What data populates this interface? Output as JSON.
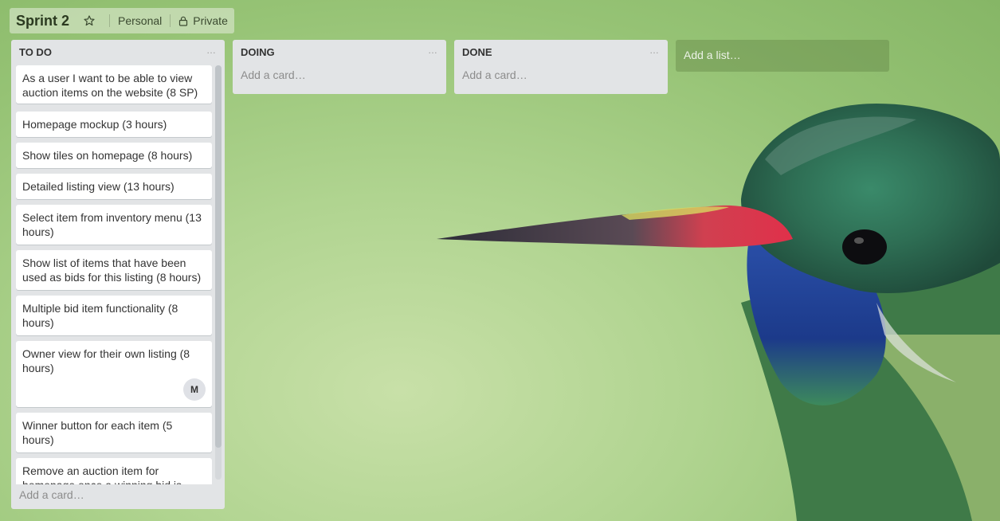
{
  "header": {
    "title": "Sprint 2",
    "star_icon": "star-outline-icon",
    "team": "Personal",
    "visibility_icon": "lock-icon",
    "visibility": "Private"
  },
  "lists": [
    {
      "title": "TO DO",
      "menu": "…",
      "add_card": "Add a card…",
      "cards": [
        {
          "text": "As a user I want to be able to view auction items on the website (8 SP)"
        },
        {
          "text": "Homepage mockup (3 hours)"
        },
        {
          "text": "Show tiles on homepage (8 hours)"
        },
        {
          "text": "Detailed listing view (13 hours)"
        },
        {
          "text": "Select item from inventory menu (13 hours)"
        },
        {
          "text": "Show list of items that have been used as bids for this listing (8 hours)"
        },
        {
          "text": "Multiple bid item functionality (8 hours)"
        },
        {
          "text": "Owner view for their own listing (8 hours)",
          "member": "M"
        },
        {
          "text": "Winner button for each item (5 hours)"
        },
        {
          "text": "Remove an auction item for homepage once a winning bid is"
        }
      ]
    },
    {
      "title": "DOING",
      "menu": "…",
      "add_card": "Add a card…",
      "cards": []
    },
    {
      "title": "DONE",
      "menu": "…",
      "add_card": "Add a card…",
      "cards": []
    }
  ],
  "add_list": "Add a list…",
  "colors": {
    "list_bg": "#e2e4e6",
    "card_bg": "#ffffff",
    "board_bg": "#a6cc84"
  }
}
